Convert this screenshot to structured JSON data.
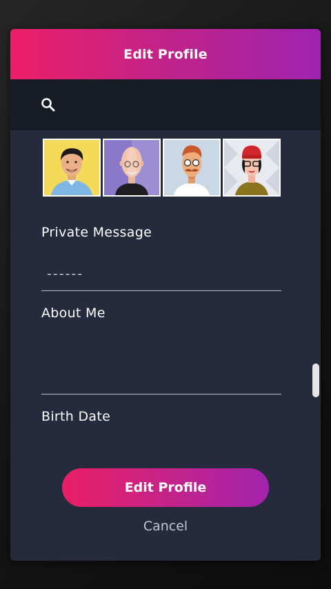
{
  "modal": {
    "title": "Edit Profile"
  },
  "search": {
    "icon": "search-icon",
    "value": ""
  },
  "avatars": [
    {
      "name": "avatar-man-smiling",
      "bg": "#f2d33a"
    },
    {
      "name": "avatar-bald-man-glasses",
      "bg": "#8a78c8"
    },
    {
      "name": "avatar-man-mustache",
      "bg": "#c9d8e4"
    },
    {
      "name": "avatar-woman-red-hat",
      "bg": "#e8eaf0"
    }
  ],
  "fields": {
    "private_message": {
      "label": "Private Message",
      "placeholder": "------"
    },
    "about_me": {
      "label": "About Me",
      "value": ""
    },
    "birth_date": {
      "label": "Birth Date"
    }
  },
  "actions": {
    "submit_label": "Edit Profile",
    "cancel_label": "Cancel"
  },
  "colors": {
    "accent_start": "#ec1f68",
    "accent_end": "#9f23b0",
    "panel": "#252b3d",
    "search_bar": "#181c25"
  }
}
